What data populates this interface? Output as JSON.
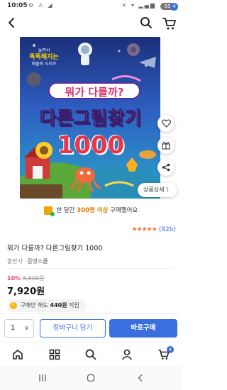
{
  "status": {
    "time": "10:05",
    "left_icons": "⚙ ⚠ ◢",
    "right_icons": "✕ ▾ ▂▄▆",
    "battery": "55"
  },
  "cart_count": "4",
  "cover": {
    "series_top": "놀면서",
    "series_mid": "똑똑해지는",
    "series_bottom": "퍼즐북 시리즈",
    "title_line1": "뭐가 다를까?",
    "title_line2": "다른그림찾기",
    "title_number": "1000"
  },
  "detail_button": "상품상세 〉",
  "promo": {
    "prefix": "한 달간",
    "highlight": "300명 이상",
    "suffix": "구매했어요"
  },
  "rating": {
    "stars": "★★★★★",
    "reviews": "(82b)"
  },
  "product": {
    "title": "뭐가 다를까? 다른그림찾기 1000",
    "publisher_label": "출판사",
    "publisher_name": "길벗스쿨",
    "discount": "10%",
    "original_price": "8,800원",
    "price": "7,920원",
    "points_prefix": "구매만 해도",
    "points_value": "440원",
    "points_suffix": "적립"
  },
  "buy_bar": {
    "qty": "1",
    "add_to_cart": "장바구니 담기",
    "buy_now": "바로구매"
  },
  "colors": {
    "accent": "#3a6fe0",
    "star": "#f07a35",
    "discount": "#e84a5f"
  }
}
